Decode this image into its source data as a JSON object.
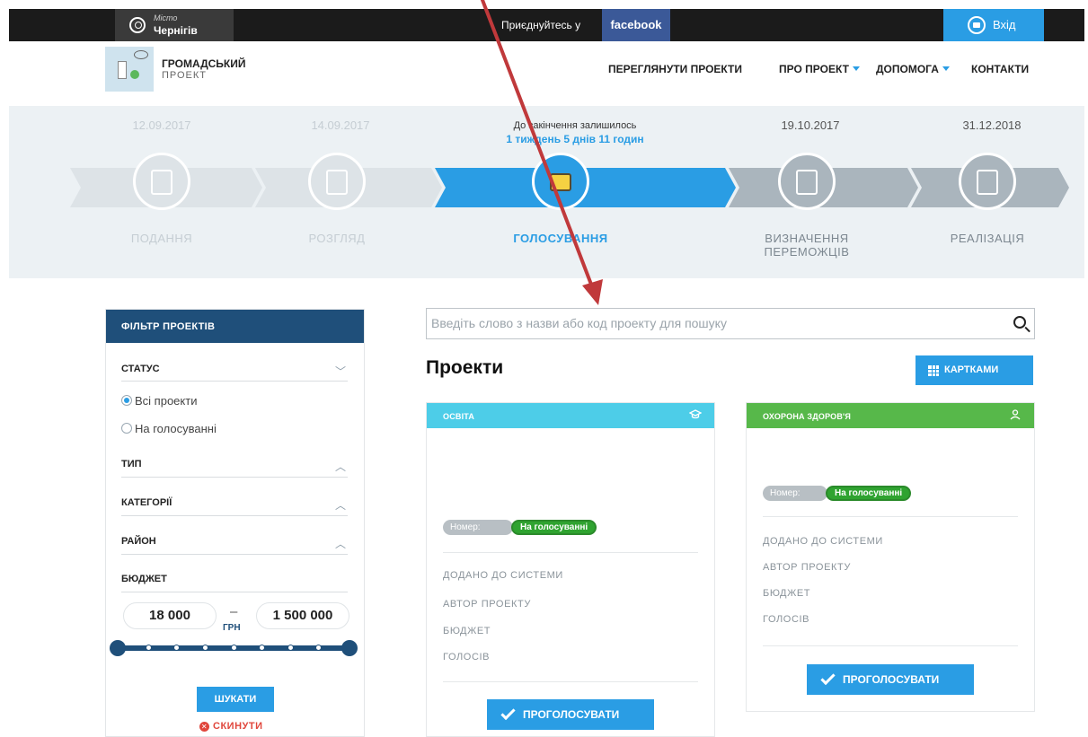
{
  "topbar": {
    "city_label": "Місто",
    "city_name": "Чернігів",
    "join_text": "Приєднуйтесь у",
    "facebook_label": "facebook",
    "login_label": "Вхід"
  },
  "header": {
    "brand_line1": "ГРОМАДСЬКИЙ",
    "brand_line2": "ПРОЕКТ",
    "nav": [
      {
        "label": "ПЕРЕГЛЯНУТИ ПРОЕКТИ"
      },
      {
        "label": "ПРО ПРОЕКТ",
        "dropdown": true
      },
      {
        "label": "ДОПОМОГА",
        "dropdown": true
      },
      {
        "label": "КОНТАКТИ"
      }
    ]
  },
  "timeline": {
    "phases": [
      {
        "date": "12.09.2017",
        "name": "ПОДАННЯ",
        "state": "done"
      },
      {
        "date": "14.09.2017",
        "name": "РОЗГЛЯД",
        "state": "done"
      },
      {
        "date_caption": "До закінчення залишилось",
        "countdown": "1 тиждень 5 днів 11 годин",
        "name": "ГОЛОСУВАННЯ",
        "state": "active"
      },
      {
        "date": "19.10.2017",
        "name_line1": "ВИЗНАЧЕННЯ",
        "name_line2": "ПЕРЕМОЖЦІВ",
        "state": "upcoming"
      },
      {
        "date": "31.12.2018",
        "name": "РЕАЛІЗАЦІЯ",
        "state": "upcoming"
      }
    ]
  },
  "filter": {
    "title": "ФІЛЬТР ПРОЕКТІВ",
    "status_label": "СТАТУС",
    "status_options": [
      {
        "label": "Всі проекти",
        "checked": true
      },
      {
        "label": "На голосуванні",
        "checked": false
      }
    ],
    "type_label": "ТИП",
    "categories_label": "КАТЕГОРІЇ",
    "district_label": "РАЙОН",
    "budget_label": "БЮДЖЕТ",
    "budget_min": "18 000",
    "budget_dash": "–",
    "budget_max": "1 500 000",
    "currency": "ГРН",
    "search_button": "ШУКАТИ",
    "reset_button": "СКИНУТИ"
  },
  "main": {
    "search_placeholder": "Введіть слово з назви або код проекту для пошуку",
    "heading": "Проекти",
    "view_toggle": "КАРТКАМИ",
    "cards": [
      {
        "category": "ОСВІТА",
        "color": "#4dcde8",
        "number_label": "Номер:",
        "status": "На голосуванні",
        "fields": [
          "ДОДАНО ДО СИСТЕМИ",
          "АВТОР ПРОЕКТУ",
          "БЮДЖЕТ",
          "ГОЛОСІВ"
        ],
        "vote_label": "ПРОГОЛОСУВАТИ"
      },
      {
        "category": "ОХОРОНА ЗДОРОВ'Я",
        "color": "#57b84a",
        "number_label": "Номер:",
        "status": "На голосуванні",
        "fields": [
          "ДОДАНО ДО СИСТЕМИ",
          "АВТОР ПРОЕКТУ",
          "БЮДЖЕТ",
          "ГОЛОСІВ"
        ],
        "vote_label": "ПРОГОЛОСУВАТИ"
      }
    ]
  },
  "colors": {
    "accent": "#2a9de4",
    "filter_header": "#1f4f7a",
    "vote_pill": "#2fa330",
    "annotation_arrow": "#c0393b"
  }
}
